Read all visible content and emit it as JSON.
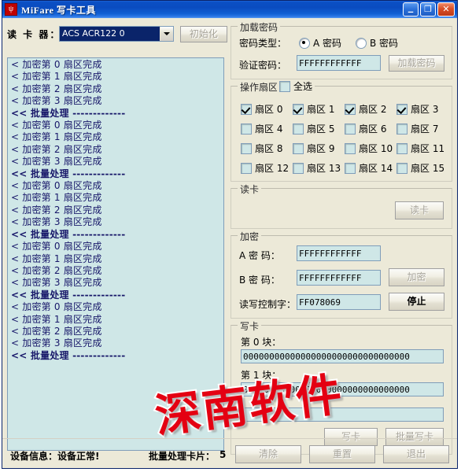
{
  "window": {
    "title": "MiFare 写卡工具",
    "icon": "app-icon",
    "buttons": {
      "minimize": "_",
      "maximize": "❐",
      "close": "✕"
    }
  },
  "reader": {
    "label": "读 卡 器：",
    "selected": "ACS ACR122 0",
    "init_button": "初始化"
  },
  "log": {
    "lines": [
      "< 加密第 0 扇区完成",
      "< 加密第 1 扇区完成",
      "< 加密第 2 扇区完成",
      "< 加密第 3 扇区完成",
      "<< 批量处理 -------------",
      "< 加密第 0 扇区完成",
      "< 加密第 1 扇区完成",
      "< 加密第 2 扇区完成",
      "< 加密第 3 扇区完成",
      "<< 批量处理 -------------",
      "< 加密第 0 扇区完成",
      "< 加密第 1 扇区完成",
      "< 加密第 2 扇区完成",
      "< 加密第 3 扇区完成",
      "<< 批量处理 -------------",
      "< 加密第 0 扇区完成",
      "< 加密第 1 扇区完成",
      "< 加密第 2 扇区完成",
      "< 加密第 3 扇区完成",
      "<< 批量处理 -------------",
      "< 加密第 0 扇区完成",
      "< 加密第 1 扇区完成",
      "< 加密第 2 扇区完成",
      "< 加密第 3 扇区完成",
      "<< 批量处理 -------------"
    ]
  },
  "load_password": {
    "group_title": "加载密码",
    "type_label": "密码类型：",
    "radio_a": "A 密码",
    "radio_b": "B 密码",
    "radio_selected": "A 密码",
    "verify_label": "验证密码：",
    "verify_value": "FFFFFFFFFFFF",
    "load_button": "加载密码"
  },
  "sectors": {
    "group_title": "操作扇区",
    "select_all_label": "全选",
    "select_all_checked": false,
    "items": [
      {
        "label": "扇区 0",
        "checked": true
      },
      {
        "label": "扇区 1",
        "checked": true
      },
      {
        "label": "扇区 2",
        "checked": true
      },
      {
        "label": "扇区 3",
        "checked": true
      },
      {
        "label": "扇区 4",
        "checked": false
      },
      {
        "label": "扇区 5",
        "checked": false
      },
      {
        "label": "扇区 6",
        "checked": false
      },
      {
        "label": "扇区 7",
        "checked": false
      },
      {
        "label": "扇区 8",
        "checked": false
      },
      {
        "label": "扇区 9",
        "checked": false
      },
      {
        "label": "扇区 10",
        "checked": false
      },
      {
        "label": "扇区 11",
        "checked": false
      },
      {
        "label": "扇区 12",
        "checked": false
      },
      {
        "label": "扇区 13",
        "checked": false
      },
      {
        "label": "扇区 14",
        "checked": false
      },
      {
        "label": "扇区 15",
        "checked": false
      }
    ]
  },
  "read_card": {
    "group_title": "读卡",
    "read_button": "读卡"
  },
  "encrypt": {
    "group_title": "加密",
    "a_label": "A 密  码：",
    "a_value": "FFFFFFFFFFFF",
    "b_label": "B 密  码：",
    "b_value": "FFFFFFFFFFFF",
    "ctrl_label": "读写控制字：",
    "ctrl_value": "FF078069",
    "encrypt_button": "加密",
    "stop_button": "停止"
  },
  "write_card": {
    "group_title": "写卡",
    "block0_label": "第 0 块：",
    "block0_value": "00000000000000000000000000000000",
    "block1_label": "第 1 块：",
    "block1_value": "00000000000000000000000000000000",
    "write_button": "写卡",
    "batch_write_button": "批量写卡"
  },
  "status": {
    "device_info": "设备信息：设备正常!",
    "batch_label": "批量处理卡片：",
    "batch_count": "5",
    "clear_button": "清除",
    "reset_button": "重置",
    "exit_button": "退出"
  },
  "watermark": {
    "text": "深南软件",
    "color": "#e40012"
  },
  "colors": {
    "dialog_bg": "#ece9d8",
    "field_bg": "#cfe7e7",
    "title_blue": "#0a4cc0",
    "log_text": "#18186a"
  }
}
